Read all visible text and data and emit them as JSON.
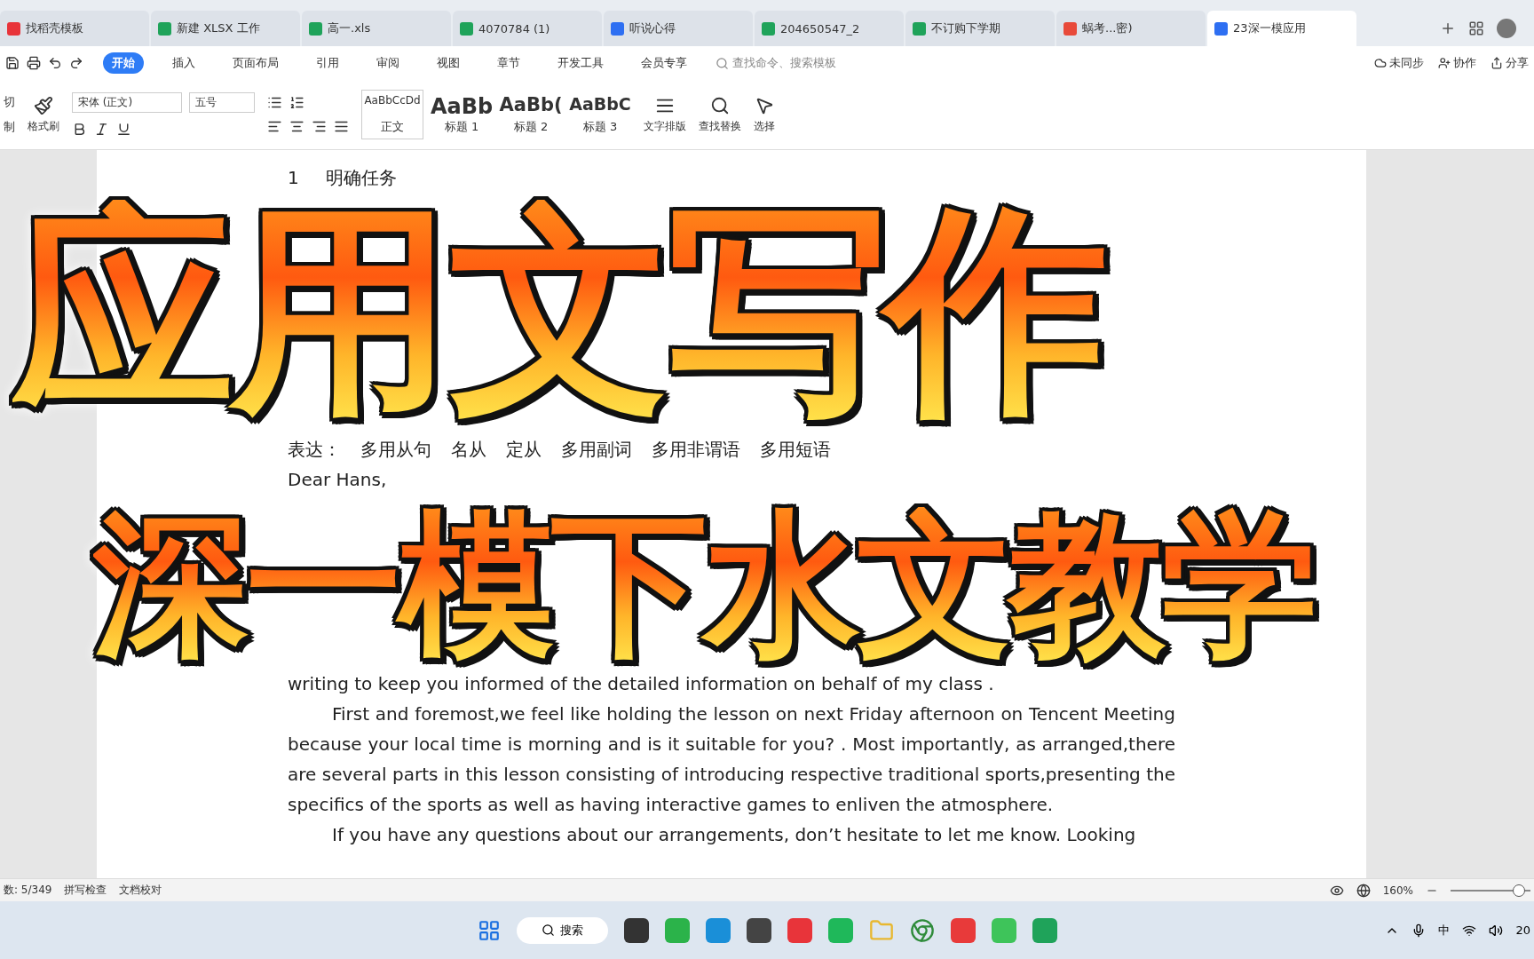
{
  "tabs": [
    {
      "label": "找稻壳模板",
      "kind": "home",
      "selected": false
    },
    {
      "label": "新建 XLSX 工作",
      "kind": "sheet",
      "selected": false
    },
    {
      "label": "高一.xls",
      "kind": "sheet",
      "selected": false
    },
    {
      "label": "4070784 (1)",
      "kind": "sheet",
      "selected": false
    },
    {
      "label": "听说心得",
      "kind": "doc",
      "selected": false
    },
    {
      "label": "204650547_2",
      "kind": "sheet",
      "selected": false
    },
    {
      "label": "不订购下学期",
      "kind": "sheet",
      "selected": false
    },
    {
      "label": "蜗考...密)",
      "kind": "pdf",
      "selected": false
    },
    {
      "label": "23深一模应用",
      "kind": "doc",
      "selected": true
    }
  ],
  "menu": {
    "items": [
      {
        "label": "开始",
        "selected": true
      },
      {
        "label": "插入",
        "selected": false
      },
      {
        "label": "页面布局",
        "selected": false
      },
      {
        "label": "引用",
        "selected": false
      },
      {
        "label": "审阅",
        "selected": false
      },
      {
        "label": "视图",
        "selected": false
      },
      {
        "label": "章节",
        "selected": false
      },
      {
        "label": "开发工具",
        "selected": false
      },
      {
        "label": "会员专享",
        "selected": false
      }
    ],
    "search": {
      "placeholder": "查找命令、搜索模板"
    },
    "right": [
      "未同步",
      "协作",
      "分享"
    ]
  },
  "ribbon": {
    "clipboard": [
      "切",
      "制"
    ],
    "format_painter": "格式刷",
    "font": "宋体 (正文)",
    "size": "五号",
    "styles": [
      {
        "sample": "AaBbCcDd",
        "name": "正文",
        "kind": "body"
      },
      {
        "sample": "AaBb",
        "name": "标题 1",
        "kind": "h1"
      },
      {
        "sample": "AaBb(",
        "name": "标题 2",
        "kind": "h2"
      },
      {
        "sample": "AaBbC",
        "name": "标题 3",
        "kind": "h3"
      }
    ],
    "tools": [
      "文字排版",
      "查找替换",
      "选择"
    ]
  },
  "document": {
    "heading_number": "1",
    "heading": "明确任务",
    "expression": [
      "表达：",
      "多用从句",
      "名从",
      "定从",
      "多用副词",
      "多用非谓语",
      "多用短语"
    ],
    "greeting": "Dear Hans,",
    "paragraphs": [
      {
        "text": "writing to keep you informed of the detailed information on behalf of my class .",
        "indent": false
      },
      {
        "text": "First and foremost,we feel like holding the lesson on next Friday afternoon on Tencent Meeting because your local time is morning and is it suitable for you? . Most importantly, as arranged,there are several parts in this lesson consisting of introducing respective traditional sports,presenting the specifics of the sports as well as having interactive games to enliven the atmosphere.",
        "indent": true
      },
      {
        "text": "If you have any questions about our arrangements, don’t hesitate to let me know. Looking",
        "indent": true
      }
    ]
  },
  "overlay": {
    "title": "应用文写作",
    "subtitle": "深一模下水文教学"
  },
  "status_bar": {
    "word_count": "数: 5/349",
    "spell_check": "拼写检查",
    "proofread": "文档校对",
    "zoom": "160%",
    "zoom_level": {
      "level": 0.85
    }
  },
  "taskbar": {
    "search": "搜索",
    "ime": "中",
    "clock": "20"
  }
}
